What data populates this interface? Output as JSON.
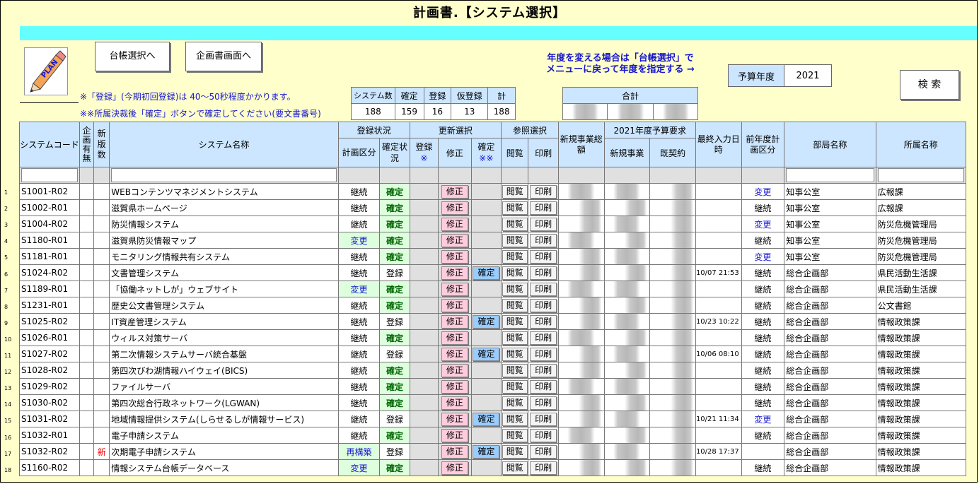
{
  "window": {
    "title": "計画書.【システム選択】"
  },
  "toolbar": {
    "plan_logo": "PLAN",
    "ledger_button": "台帳選択へ",
    "plan_screen_button": "企画書画面へ",
    "search_button": "検 索"
  },
  "notes": {
    "line1": "※「登録」(今期初回登録)は 40～50秒程度かかります。",
    "line2": "※※所属決裁後「確定」ボタンで確定してください(要文書番号)",
    "year_change_line1": "年度を変える場合は「台帳選択」で",
    "year_change_line2": "メニューに戻って年度を指定する →"
  },
  "budget_year": {
    "label": "予算年度",
    "value": "2021"
  },
  "summary": {
    "headers": [
      "システム数",
      "確定",
      "登録",
      "仮登録",
      "計"
    ],
    "values": [
      "188",
      "159",
      "16",
      "13",
      "188"
    ],
    "total_label": "合計"
  },
  "table": {
    "h_system_code": "システムコード",
    "h_plan_flag": "企画有無",
    "h_new_ver": "新版数",
    "h_system_name": "システム名称",
    "h_reg_status": "登録状況",
    "h_plan_div": "計画区分",
    "h_conf_status": "確定状況",
    "h_update_select": "更新選択",
    "h_register": "登録",
    "h_register_mark": "※",
    "h_modify": "修正",
    "h_confirm": "確定",
    "h_confirm_mark": "※※",
    "h_ref_select": "参照選択",
    "h_view": "閲覧",
    "h_print": "印刷",
    "h_new_total": "新規事業総額",
    "h_budget_req": "2021年度予算要求",
    "h_new_biz": "新規事業",
    "h_existing": "既契約",
    "h_last_input": "最終入力日時",
    "h_prev_div": "前年度計画区分",
    "h_dept": "部局名称",
    "h_section": "所属名称",
    "btn_modify": "修正",
    "btn_confirm": "確定",
    "btn_view": "閲覧",
    "btn_print": "印刷",
    "rows": [
      {
        "no": "1",
        "code": "S1001-R02",
        "flag": "",
        "name": "WEBコンテンツマネジメントシステム",
        "plan": "継続",
        "status": "確定",
        "confirm": false,
        "last": "",
        "prev": "変更",
        "dept": "知事公室",
        "section": "広報課"
      },
      {
        "no": "2",
        "code": "S1002-R01",
        "flag": "",
        "name": "滋賀県ホームページ",
        "plan": "継続",
        "status": "確定",
        "confirm": false,
        "last": "",
        "prev": "継続",
        "dept": "知事公室",
        "section": "広報課"
      },
      {
        "no": "3",
        "code": "S1004-R02",
        "flag": "",
        "name": "防災情報システム",
        "plan": "継続",
        "status": "確定",
        "confirm": false,
        "last": "",
        "prev": "変更",
        "dept": "知事公室",
        "section": "防災危機管理局"
      },
      {
        "no": "4",
        "code": "S1180-R01",
        "flag": "",
        "name": "滋賀県防災情報マップ",
        "plan": "変更",
        "status": "確定",
        "confirm": false,
        "last": "",
        "prev": "継続",
        "dept": "知事公室",
        "section": "防災危機管理局"
      },
      {
        "no": "5",
        "code": "S1181-R01",
        "flag": "",
        "name": "モニタリング情報共有システム",
        "plan": "継続",
        "status": "確定",
        "confirm": false,
        "last": "",
        "prev": "変更",
        "dept": "知事公室",
        "section": "防災危機管理局"
      },
      {
        "no": "6",
        "code": "S1024-R02",
        "flag": "",
        "name": "文書管理システム",
        "plan": "継続",
        "status": "登録",
        "confirm": true,
        "last": "10/07 21:53",
        "prev": "継続",
        "dept": "総合企画部",
        "section": "県民活動生活課"
      },
      {
        "no": "7",
        "code": "S1189-R01",
        "flag": "",
        "name": "「協働ネットしが」ウェブサイト",
        "plan": "変更",
        "status": "確定",
        "confirm": false,
        "last": "",
        "prev": "継続",
        "dept": "総合企画部",
        "section": "県民活動生活課"
      },
      {
        "no": "8",
        "code": "S1231-R01",
        "flag": "",
        "name": "歴史公文書管理システム",
        "plan": "継続",
        "status": "確定",
        "confirm": false,
        "last": "",
        "prev": "継続",
        "dept": "総合企画部",
        "section": "公文書館"
      },
      {
        "no": "9",
        "code": "S1025-R02",
        "flag": "",
        "name": "IT資産管理システム",
        "plan": "継続",
        "status": "登録",
        "confirm": true,
        "last": "10/23 10:22",
        "prev": "継続",
        "dept": "総合企画部",
        "section": "情報政策課"
      },
      {
        "no": "10",
        "code": "S1026-R01",
        "flag": "",
        "name": "ウィルス対策サーバ",
        "plan": "継続",
        "status": "確定",
        "confirm": false,
        "last": "",
        "prev": "継続",
        "dept": "総合企画部",
        "section": "情報政策課"
      },
      {
        "no": "11",
        "code": "S1027-R02",
        "flag": "",
        "name": "第二次情報システムサーバ統合基盤",
        "plan": "継続",
        "status": "登録",
        "confirm": true,
        "last": "10/06 08:10",
        "prev": "継続",
        "dept": "総合企画部",
        "section": "情報政策課"
      },
      {
        "no": "12",
        "code": "S1028-R02",
        "flag": "",
        "name": "第四次びわ湖情報ハイウェイ(BICS)",
        "plan": "継続",
        "status": "確定",
        "confirm": false,
        "last": "",
        "prev": "継続",
        "dept": "総合企画部",
        "section": "情報政策課"
      },
      {
        "no": "13",
        "code": "S1029-R02",
        "flag": "",
        "name": "ファイルサーバ",
        "plan": "継続",
        "status": "確定",
        "confirm": false,
        "last": "",
        "prev": "継続",
        "dept": "総合企画部",
        "section": "情報政策課"
      },
      {
        "no": "14",
        "code": "S1030-R02",
        "flag": "",
        "name": "第四次総合行政ネットワーク(LGWAN)",
        "plan": "継続",
        "status": "確定",
        "confirm": false,
        "last": "",
        "prev": "継続",
        "dept": "総合企画部",
        "section": "情報政策課"
      },
      {
        "no": "15",
        "code": "S1031-R02",
        "flag": "",
        "name": "地域情報提供システム(しらせるしが情報サービス)",
        "plan": "継続",
        "status": "登録",
        "confirm": true,
        "last": "10/21 11:34",
        "prev": "変更",
        "dept": "総合企画部",
        "section": "情報政策課"
      },
      {
        "no": "16",
        "code": "S1032-R01",
        "flag": "",
        "name": "電子申請システム",
        "plan": "継続",
        "status": "確定",
        "confirm": false,
        "last": "",
        "prev": "継続",
        "dept": "総合企画部",
        "section": "情報政策課"
      },
      {
        "no": "17",
        "code": "S1032-R02",
        "flag": "新",
        "name": "次期電子申請システム",
        "plan": "再構築",
        "status": "登録",
        "confirm": true,
        "last": "10/28 17:37",
        "prev": "",
        "dept": "総合企画部",
        "section": "情報政策課"
      },
      {
        "no": "18",
        "code": "S1160-R02",
        "flag": "",
        "name": "情報システム台帳データベース",
        "plan": "変更",
        "status": "確定",
        "confirm": false,
        "last": "",
        "prev": "継続",
        "dept": "総合企画部",
        "section": "情報政策課"
      }
    ]
  },
  "colors": {
    "background": "#ffffcc",
    "cyan_bar": "#66ffff",
    "header": "#cce6ff",
    "confirmed": "#006600",
    "modify_btn": "#ffccdd",
    "confirm_btn": "#99ccff",
    "link_blue": "#1515d0"
  }
}
